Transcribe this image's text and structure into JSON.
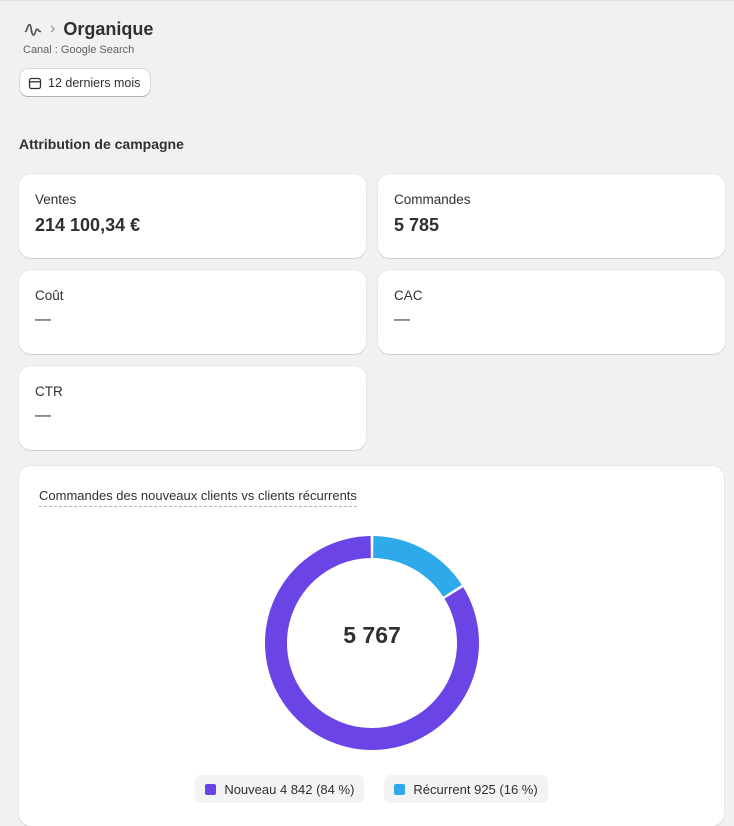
{
  "header": {
    "channel_icon": "wave-icon",
    "title": "Organique",
    "subtitle": "Canal : Google Search"
  },
  "date_range": {
    "label": "12 derniers mois",
    "icon": "calendar-icon"
  },
  "section": {
    "title": "Attribution de campagne"
  },
  "metrics": [
    {
      "label": "Ventes",
      "value": "214 100,34 €"
    },
    {
      "label": "Commandes",
      "value": "5 785"
    },
    {
      "label": "Coût",
      "value": "—"
    },
    {
      "label": "CAC",
      "value": "—"
    },
    {
      "label": "CTR",
      "value": "—"
    }
  ],
  "donut": {
    "title": "Commandes des nouveaux clients vs clients récurrents",
    "total": "5 767",
    "legend": [
      {
        "label": "Nouveau 4 842 (84 %)"
      },
      {
        "label": "Récurrent 925 (16 %)"
      }
    ]
  },
  "chart_data": {
    "type": "pie",
    "title": "Commandes des nouveaux clients vs clients récurrents",
    "categories": [
      "Nouveau",
      "Récurrent"
    ],
    "values": [
      4842,
      925
    ],
    "percentages": [
      84,
      16
    ],
    "total": 5767,
    "colors": [
      "#6b44e6",
      "#2eaaea"
    ],
    "legend": "bottom"
  }
}
